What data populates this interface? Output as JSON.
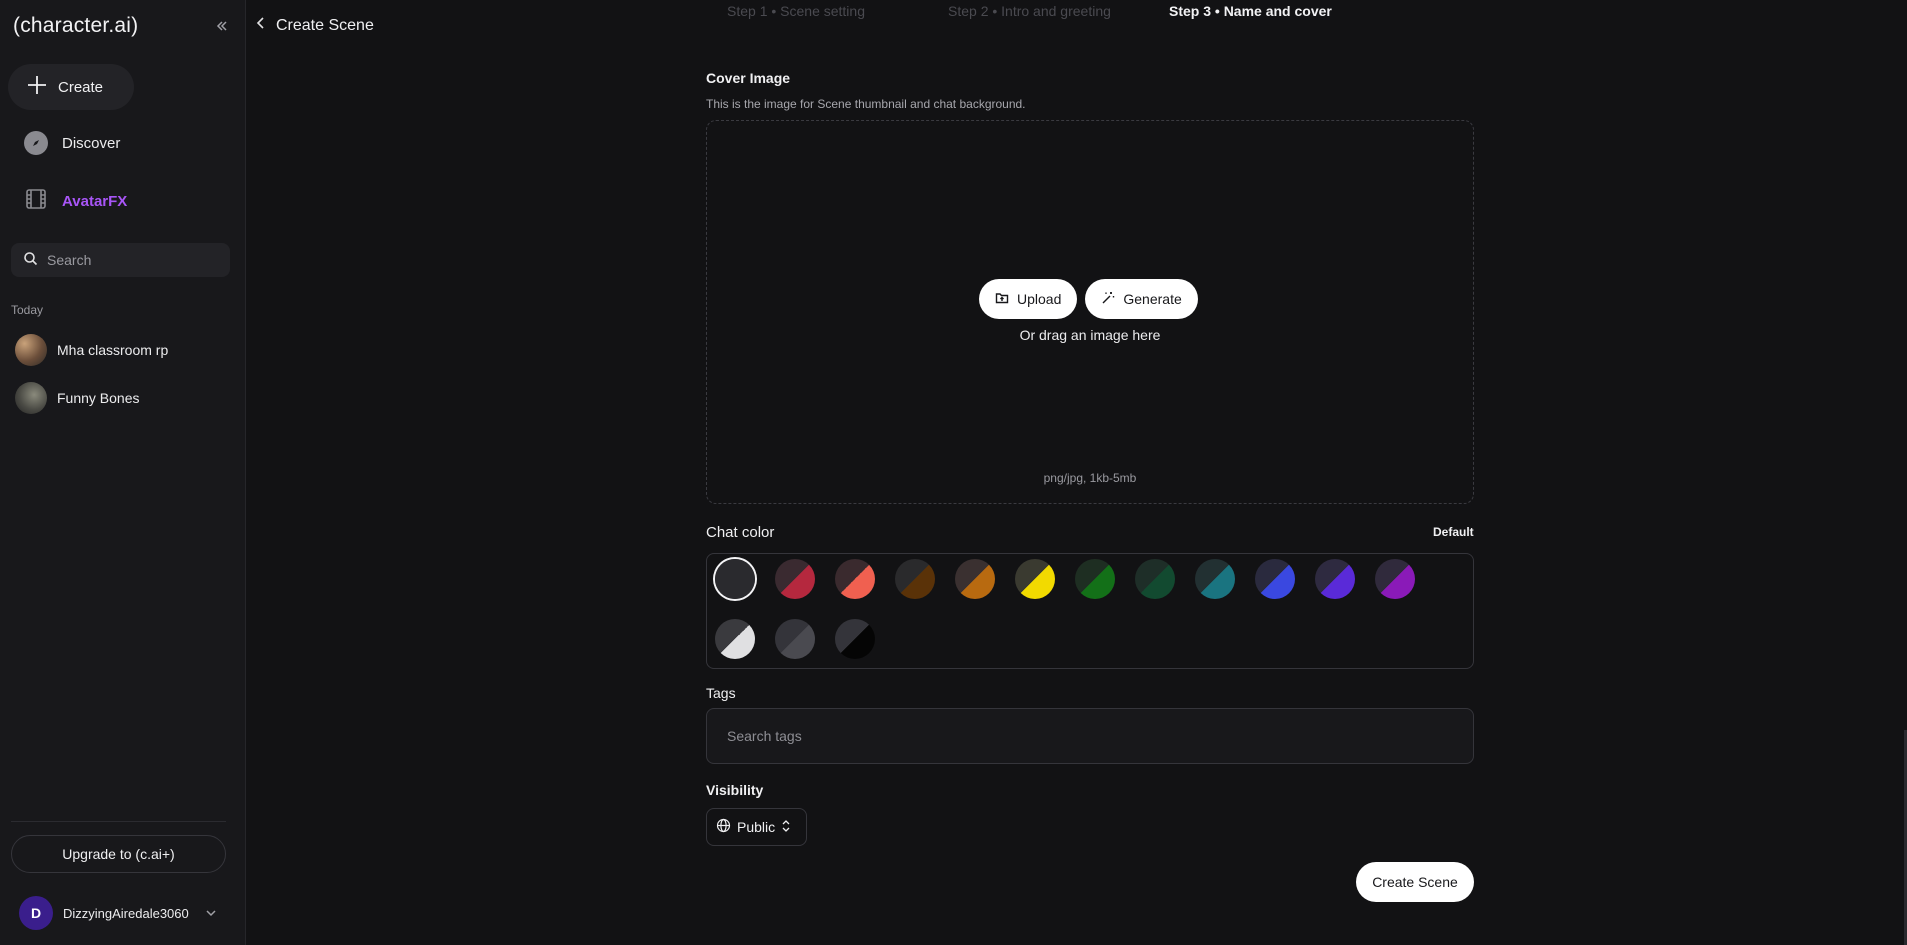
{
  "sidebar": {
    "logo": "(character.ai)",
    "create_label": "Create",
    "nav": {
      "discover": "Discover",
      "avatarfx": "AvatarFX"
    },
    "search_placeholder": "Search",
    "section_today": "Today",
    "chats": [
      {
        "name": "Mha classroom rp"
      },
      {
        "name": "Funny Bones"
      }
    ],
    "upgrade_label": "Upgrade to (c.ai+)",
    "user": {
      "initial": "D",
      "name": "DizzyingAiredale3060"
    }
  },
  "header": {
    "title": "Create Scene",
    "steps": [
      "Step 1 • Scene setting",
      "Step 2 • Intro and greeting",
      "Step 3 • Name and cover"
    ],
    "active_step": 3
  },
  "cover": {
    "title": "Cover Image",
    "description": "This is the image for Scene thumbnail and chat background.",
    "upload_label": "Upload",
    "generate_label": "Generate",
    "drag_text": "Or drag an image here",
    "hint": "png/jpg, 1kb-5mb"
  },
  "chat_color": {
    "title": "Chat color",
    "default_label": "Default",
    "selected_index": 0,
    "swatches": [
      {
        "a": "#2a2a2e",
        "b": "#2a2a2e"
      },
      {
        "a": "#3a2a30",
        "b": "#b5283e"
      },
      {
        "a": "#3a2a2e",
        "b": "#f06050"
      },
      {
        "a": "#2a2a2c",
        "b": "#5a3208"
      },
      {
        "a": "#3a3030",
        "b": "#b86a10"
      },
      {
        "a": "#3a3a30",
        "b": "#f2da00"
      },
      {
        "a": "#1e2e22",
        "b": "#137018"
      },
      {
        "a": "#1e2e28",
        "b": "#124a30"
      },
      {
        "a": "#223032",
        "b": "#1a7480"
      },
      {
        "a": "#2a2a3e",
        "b": "#3a48e0"
      },
      {
        "a": "#2e2a40",
        "b": "#5a2ad8"
      },
      {
        "a": "#302a3c",
        "b": "#8a1ab8"
      },
      {
        "a": "#3a3a3e",
        "b": "#e0e0e2"
      },
      {
        "a": "#34343a",
        "b": "#4a4a50"
      },
      {
        "a": "#34343a",
        "b": "#050505"
      }
    ]
  },
  "tags": {
    "title": "Tags",
    "placeholder": "Search tags"
  },
  "visibility": {
    "title": "Visibility",
    "value": "Public"
  },
  "submit_label": "Create Scene"
}
